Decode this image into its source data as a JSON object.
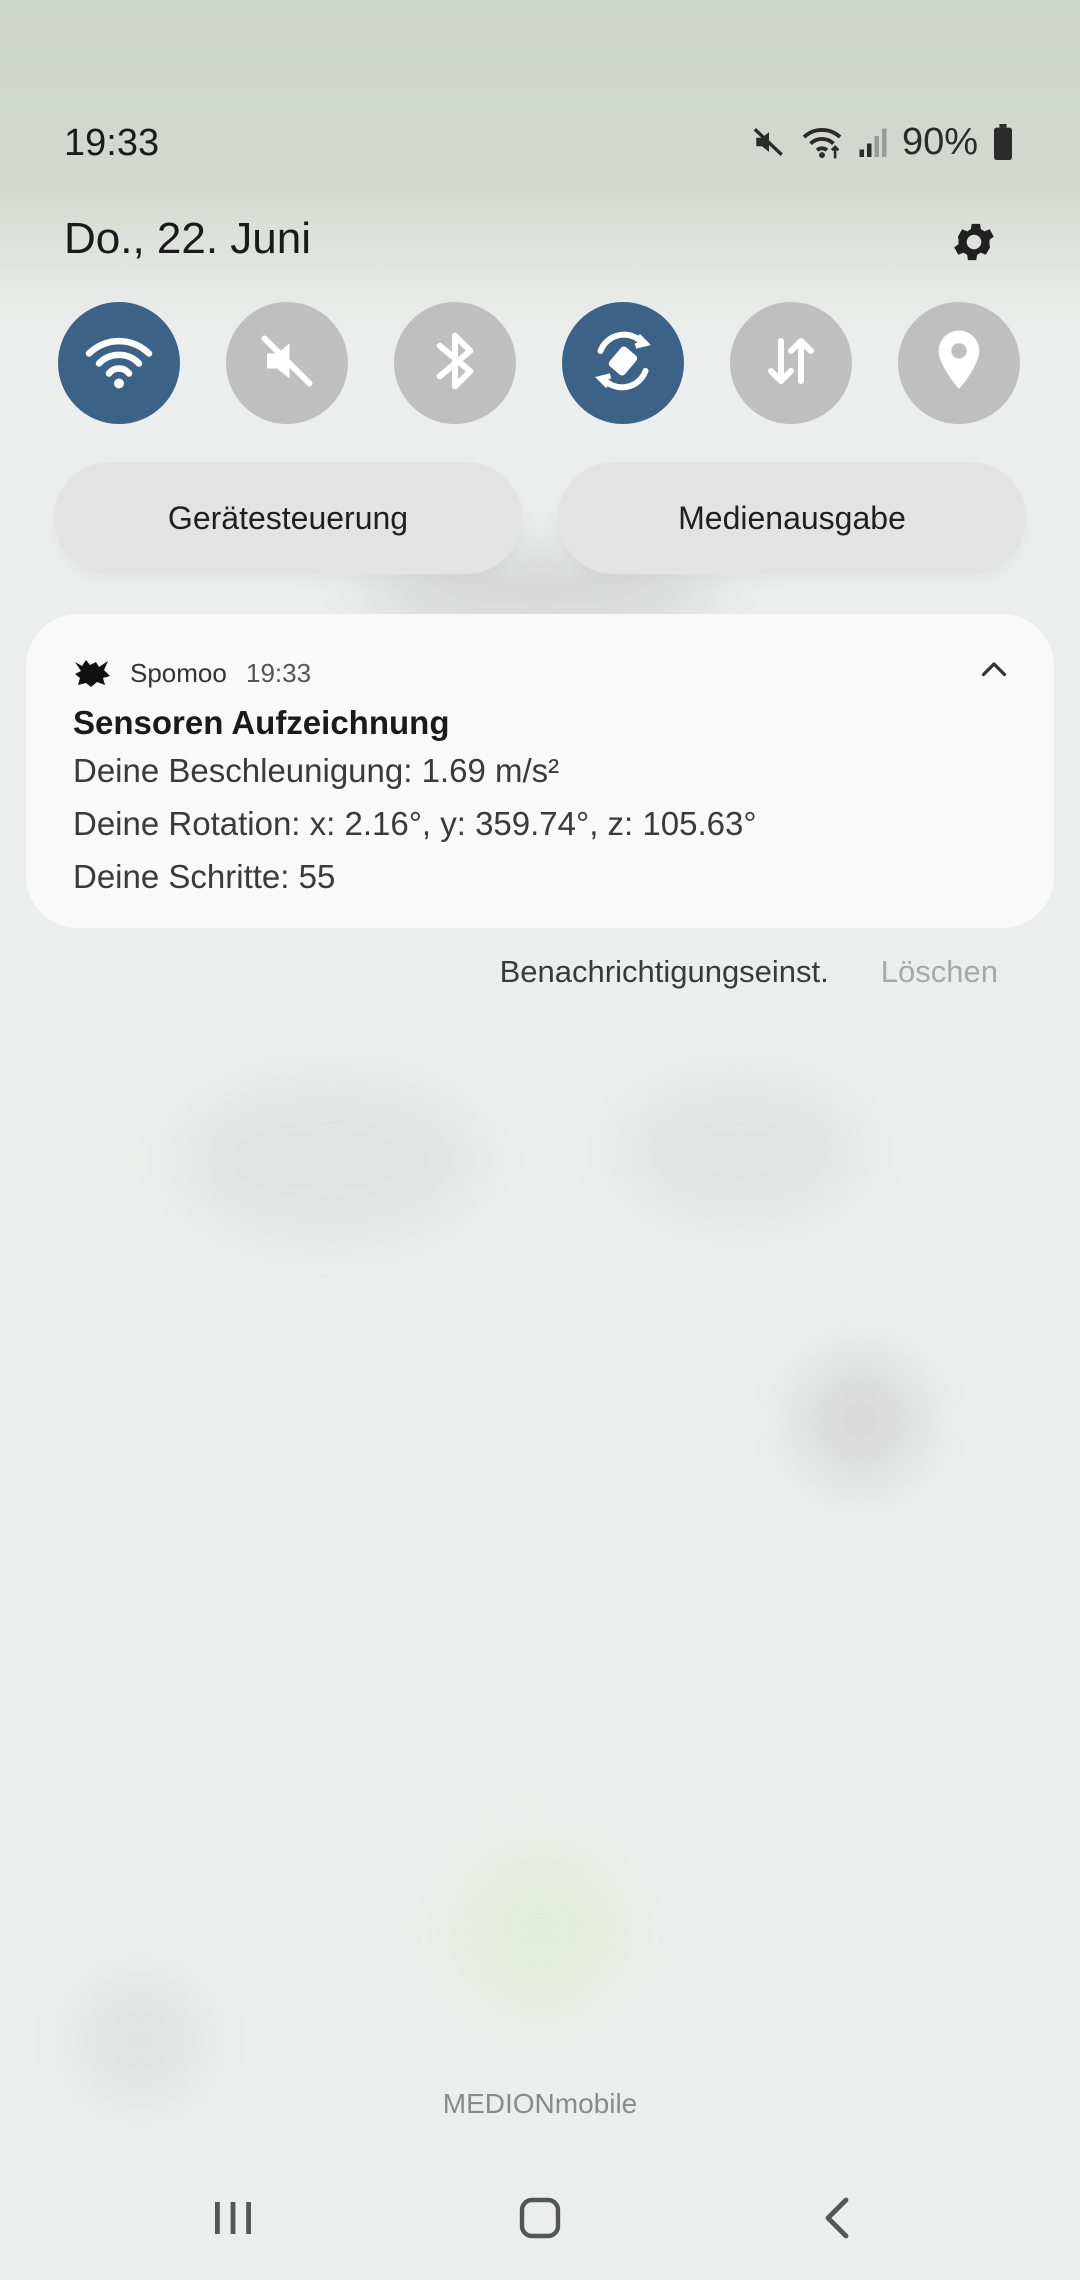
{
  "status_bar": {
    "time": "19:33",
    "battery": "90%",
    "icons": [
      "mute-icon",
      "wifi-icon",
      "signal-icon",
      "battery-icon"
    ]
  },
  "header": {
    "date": "Do., 22. Juni",
    "settings_icon": "gear-icon"
  },
  "quick_settings": [
    {
      "name": "wifi",
      "icon": "wifi-icon",
      "active": true
    },
    {
      "name": "sound",
      "icon": "mute-icon",
      "active": false
    },
    {
      "name": "bluetooth",
      "icon": "bluetooth-icon",
      "active": false
    },
    {
      "name": "auto-rotate",
      "icon": "rotate-icon",
      "active": true
    },
    {
      "name": "mobile-data",
      "icon": "data-arrows-icon",
      "active": false
    },
    {
      "name": "location",
      "icon": "location-pin-icon",
      "active": false
    }
  ],
  "buttons": {
    "device_control": "Gerätesteuerung",
    "media_output": "Medienausgabe"
  },
  "notification": {
    "app_name": "Spomoo",
    "time": "19:33",
    "title": "Sensoren Aufzeichnung",
    "lines": [
      "Deine Beschleunigung: 1.69 m/s²",
      "Deine Rotation: x: 2.16°, y: 359.74°, z: 105.63°",
      "Deine Schritte: 55"
    ]
  },
  "notification_actions": {
    "settings": "Benachrichtigungseinst.",
    "clear": "Löschen"
  },
  "carrier": "MEDIONmobile",
  "colors": {
    "active_tile": "#3c6287",
    "inactive_tile": "#bebfbe",
    "card_bg": "#f9f9f9"
  }
}
